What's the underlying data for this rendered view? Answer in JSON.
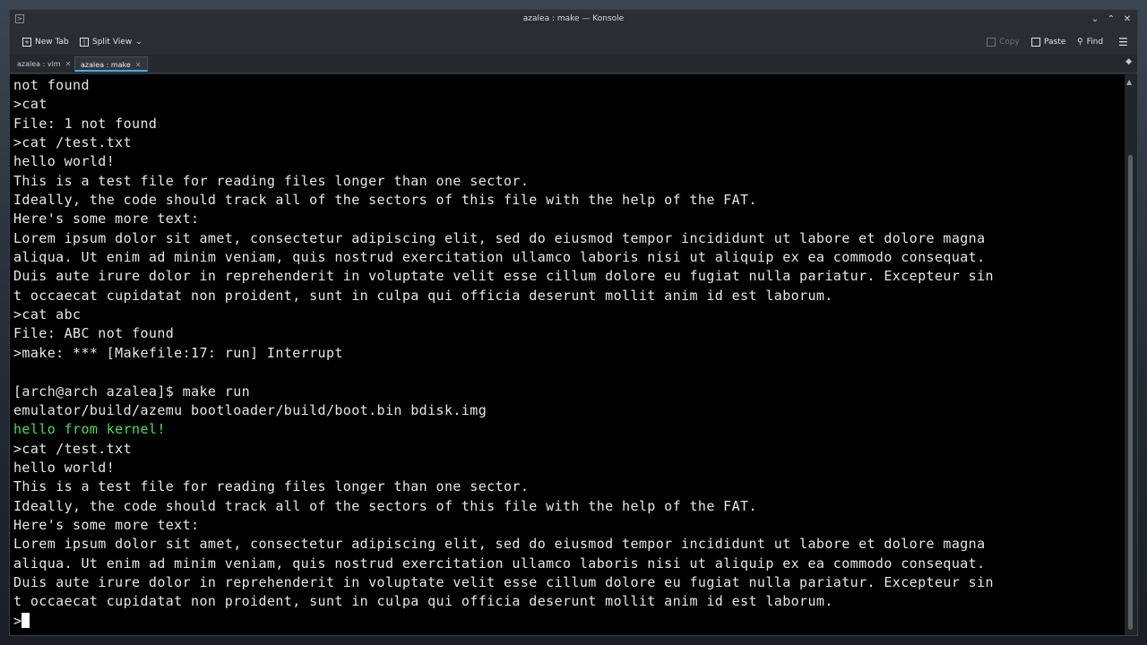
{
  "window": {
    "title": "azalea : make — Konsole"
  },
  "toolbar": {
    "new_tab": "New Tab",
    "split_view": "Split View",
    "copy": "Copy",
    "paste": "Paste",
    "find": "Find"
  },
  "tabs": [
    {
      "label": "azalea : vim",
      "active": false
    },
    {
      "label": "azalea : make",
      "active": true
    }
  ],
  "terminal": {
    "lines": [
      {
        "text": "not found"
      },
      {
        "text": ">cat"
      },
      {
        "text": "File: 1 not found"
      },
      {
        "text": ">cat /test.txt"
      },
      {
        "text": "hello world!"
      },
      {
        "text": "This is a test file for reading files longer than one sector."
      },
      {
        "text": "Ideally, the code should track all of the sectors of this file with the help of the FAT."
      },
      {
        "text": "Here's some more text:"
      },
      {
        "text": "Lorem ipsum dolor sit amet, consectetur adipiscing elit, sed do eiusmod tempor incididunt ut labore et dolore magna"
      },
      {
        "text": "aliqua. Ut enim ad minim veniam, quis nostrud exercitation ullamco laboris nisi ut aliquip ex ea commodo consequat."
      },
      {
        "text": "Duis aute irure dolor in reprehenderit in voluptate velit esse cillum dolore eu fugiat nulla pariatur. Excepteur sin"
      },
      {
        "text": "t occaecat cupidatat non proident, sunt in culpa qui officia deserunt mollit anim id est laborum."
      },
      {
        "text": ">cat abc"
      },
      {
        "text": "File: ABC not found"
      },
      {
        "text": ">make: *** [Makefile:17: run] Interrupt"
      },
      {
        "text": ""
      },
      {
        "text": "[arch@arch azalea]$ make run"
      },
      {
        "text": "emulator/build/azemu bootloader/build/boot.bin bdisk.img"
      },
      {
        "text": "hello from kernel!",
        "color": "#44e04a"
      },
      {
        "text": ">cat /test.txt"
      },
      {
        "text": "hello world!"
      },
      {
        "text": "This is a test file for reading files longer than one sector."
      },
      {
        "text": "Ideally, the code should track all of the sectors of this file with the help of the FAT."
      },
      {
        "text": "Here's some more text:"
      },
      {
        "text": "Lorem ipsum dolor sit amet, consectetur adipiscing elit, sed do eiusmod tempor incididunt ut labore et dolore magna"
      },
      {
        "text": "aliqua. Ut enim ad minim veniam, quis nostrud exercitation ullamco laboris nisi ut aliquip ex ea commodo consequat."
      },
      {
        "text": "Duis aute irure dolor in reprehenderit in voluptate velit esse cillum dolore eu fugiat nulla pariatur. Excepteur sin"
      },
      {
        "text": "t occaecat cupidatat non proident, sunt in culpa qui officia deserunt mollit anim id est laborum."
      }
    ],
    "prompt": ">"
  },
  "icons": {
    "app": "konsole-icon",
    "new_tab": "new-tab-icon",
    "split_view": "split-view-icon",
    "copy": "copy-icon",
    "paste": "paste-icon",
    "find": "search-icon",
    "menu": "hamburger-menu-icon"
  },
  "colors": {
    "terminal_bg": "#000000",
    "terminal_fg": "#e6e6e6",
    "kernel_text": "#44e04a",
    "accent": "#3daee9"
  }
}
